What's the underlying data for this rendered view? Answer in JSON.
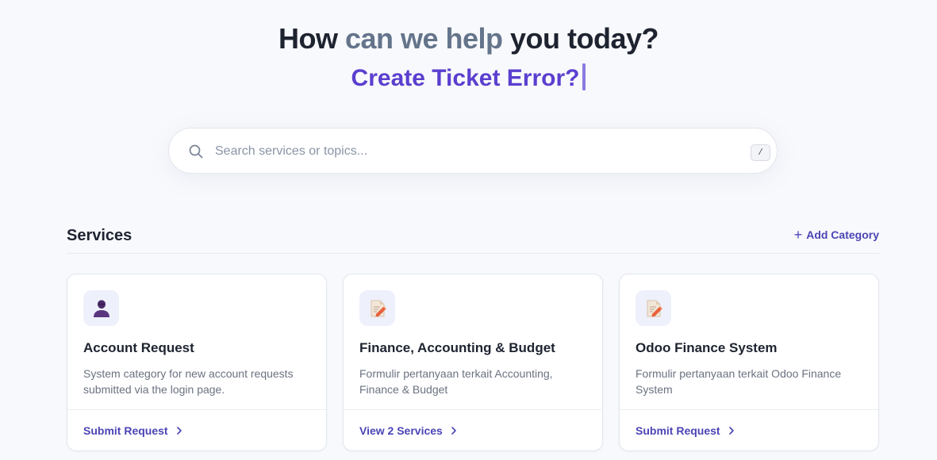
{
  "hero": {
    "headline_part1": "How",
    "headline_part2": " can we help ",
    "headline_part3": "you today?",
    "typed_text": "Create Ticket Error?"
  },
  "search": {
    "placeholder": "Search services or topics...",
    "value": "",
    "shortcut": "/"
  },
  "services_section": {
    "title": "Services",
    "add_label": "Add Category"
  },
  "cards": [
    {
      "title": "Account Request",
      "description": "System category for new account requests submitted via the login page.",
      "action": "Submit Request",
      "icon": "user-icon"
    },
    {
      "title": "Finance, Accounting & Budget",
      "description": "Formulir pertanyaan terkait Accounting, Finance & Budget",
      "action": "View 2 Services",
      "icon": "document-edit-icon"
    },
    {
      "title": "Odoo Finance System",
      "description": "Formulir pertanyaan terkait Odoo Finance System",
      "action": "Submit Request",
      "icon": "document-edit-icon"
    }
  ],
  "colors": {
    "accent": "#5b3fcf",
    "link": "#4b45b5",
    "background": "#f8f9fc"
  }
}
